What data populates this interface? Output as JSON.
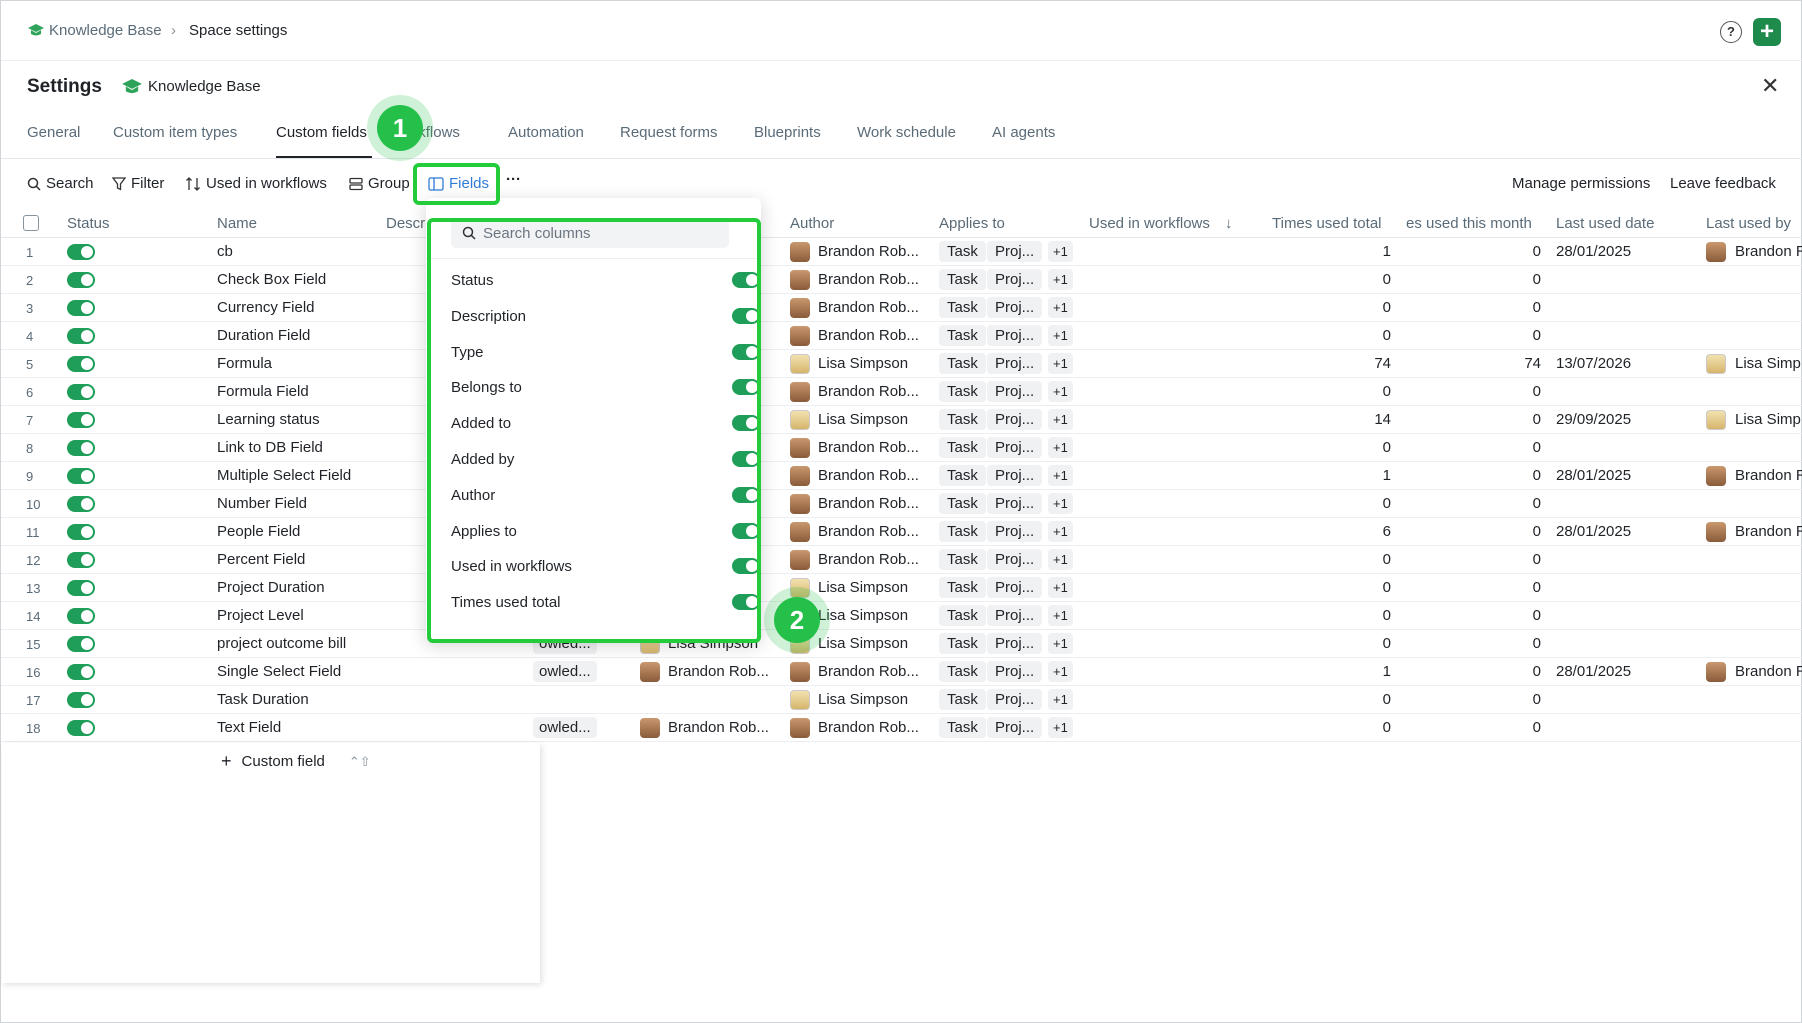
{
  "breadcrumb": {
    "workspace": "Knowledge Base",
    "current": "Space settings"
  },
  "header": {
    "help_label": "?",
    "add_label": "+",
    "title": "Settings",
    "workspace": "Knowledge Base",
    "close_label": "✕"
  },
  "tabs": [
    {
      "label": "General"
    },
    {
      "label": "Custom item types"
    },
    {
      "label": "Custom fields"
    },
    {
      "label": "Workflows"
    },
    {
      "label": "Automation"
    },
    {
      "label": "Request forms"
    },
    {
      "label": "Blueprints"
    },
    {
      "label": "Work schedule"
    },
    {
      "label": "AI agents"
    }
  ],
  "toolbar": {
    "search": "Search",
    "filter": "Filter",
    "used_in_workflows": "Used in workflows",
    "group": "Group",
    "fields": "Fields",
    "more": "···",
    "manage_permissions": "Manage permissions",
    "leave_feedback": "Leave feedback"
  },
  "columns": {
    "status": "Status",
    "name": "Name",
    "description": "Descr",
    "author": "Author",
    "applies_to": "Applies to",
    "used_in_workflows": "Used in workflows",
    "times_used_total": "Times used total",
    "times_used_month": "es used this month",
    "last_used_date": "Last used date",
    "last_used_by": "Last used by"
  },
  "rows": [
    {
      "idx": "1",
      "name": "cb",
      "author": "Brandon Rob...",
      "author_avatar": "b",
      "tag1": "Task",
      "tag2": "Proj...",
      "more": "+1",
      "total": "1",
      "month": "0",
      "date": "28/01/2025",
      "last_by": "Brandon R",
      "last_avatar": "b"
    },
    {
      "idx": "2",
      "name": "Check Box Field",
      "author": "Brandon Rob...",
      "author_avatar": "b",
      "tag1": "Task",
      "tag2": "Proj...",
      "more": "+1",
      "total": "0",
      "month": "0",
      "date": "",
      "last_by": "",
      "last_avatar": ""
    },
    {
      "idx": "3",
      "name": "Currency Field",
      "author": "Brandon Rob...",
      "author_avatar": "b",
      "tag1": "Task",
      "tag2": "Proj...",
      "more": "+1",
      "total": "0",
      "month": "0",
      "date": "",
      "last_by": "",
      "last_avatar": ""
    },
    {
      "idx": "4",
      "name": "Duration Field",
      "author": "Brandon Rob...",
      "author_avatar": "b",
      "tag1": "Task",
      "tag2": "Proj...",
      "more": "+1",
      "total": "0",
      "month": "0",
      "date": "",
      "last_by": "",
      "last_avatar": ""
    },
    {
      "idx": "5",
      "name": "Formula",
      "author": "Lisa Simpson",
      "author_avatar": "l",
      "tag1": "Task",
      "tag2": "Proj...",
      "more": "+1",
      "total": "74",
      "month": "74",
      "date": "13/07/2026",
      "last_by": "Lisa Simp",
      "last_avatar": "l"
    },
    {
      "idx": "6",
      "name": "Formula Field",
      "author": "Brandon Rob...",
      "author_avatar": "b",
      "tag1": "Task",
      "tag2": "Proj...",
      "more": "+1",
      "total": "0",
      "month": "0",
      "date": "",
      "last_by": "",
      "last_avatar": ""
    },
    {
      "idx": "7",
      "name": "Learning status",
      "author": "Lisa Simpson",
      "author_avatar": "l",
      "tag1": "Task",
      "tag2": "Proj...",
      "more": "+1",
      "total": "14",
      "month": "0",
      "date": "29/09/2025",
      "last_by": "Lisa Simp",
      "last_avatar": "l"
    },
    {
      "idx": "8",
      "name": "Link to DB Field",
      "author": "Brandon Rob...",
      "author_avatar": "b",
      "tag1": "Task",
      "tag2": "Proj...",
      "more": "+1",
      "total": "0",
      "month": "0",
      "date": "",
      "last_by": "",
      "last_avatar": ""
    },
    {
      "idx": "9",
      "name": "Multiple Select Field",
      "author": "Brandon Rob...",
      "author_avatar": "b",
      "tag1": "Task",
      "tag2": "Proj...",
      "more": "+1",
      "total": "1",
      "month": "0",
      "date": "28/01/2025",
      "last_by": "Brandon R",
      "last_avatar": "b"
    },
    {
      "idx": "10",
      "name": "Number Field",
      "author": "Brandon Rob...",
      "author_avatar": "b",
      "tag1": "Task",
      "tag2": "Proj...",
      "more": "+1",
      "total": "0",
      "month": "0",
      "date": "",
      "last_by": "",
      "last_avatar": ""
    },
    {
      "idx": "11",
      "name": "People Field",
      "author": "Brandon Rob...",
      "author_avatar": "b",
      "tag1": "Task",
      "tag2": "Proj...",
      "more": "+1",
      "total": "6",
      "month": "0",
      "date": "28/01/2025",
      "last_by": "Brandon R",
      "last_avatar": "b"
    },
    {
      "idx": "12",
      "name": "Percent Field",
      "author": "Brandon Rob...",
      "author_avatar": "b",
      "tag1": "Task",
      "tag2": "Proj...",
      "more": "+1",
      "total": "0",
      "month": "0",
      "date": "",
      "last_by": "",
      "last_avatar": ""
    },
    {
      "idx": "13",
      "name": "Project Duration",
      "author": "Lisa Simpson",
      "author_avatar": "l",
      "tag1": "Task",
      "tag2": "Proj...",
      "more": "+1",
      "total": "0",
      "month": "0",
      "date": "",
      "last_by": "",
      "last_avatar": ""
    },
    {
      "idx": "14",
      "name": "Project Level",
      "author": "Lisa Simpson",
      "author_avatar": "l",
      "tag1": "Task",
      "tag2": "Proj...",
      "more": "+1",
      "total": "0",
      "month": "0",
      "date": "",
      "last_by": "",
      "last_avatar": ""
    },
    {
      "idx": "15",
      "name": "project outcome bill",
      "author": "Lisa Simpson",
      "author_avatar": "l",
      "tag1": "Task",
      "tag2": "Proj...",
      "more": "+1",
      "total": "0",
      "month": "0",
      "date": "",
      "last_by": "",
      "last_avatar": "",
      "belongs": "owled...",
      "added_by": "Lisa Simpson",
      "added_avatar": "l"
    },
    {
      "idx": "16",
      "name": "Single Select Field",
      "author": "Brandon Rob...",
      "author_avatar": "b",
      "tag1": "Task",
      "tag2": "Proj...",
      "more": "+1",
      "total": "1",
      "month": "0",
      "date": "28/01/2025",
      "last_by": "Brandon R",
      "last_avatar": "b",
      "belongs": "owled...",
      "added_by": "Brandon Rob...",
      "added_avatar": "b"
    },
    {
      "idx": "17",
      "name": "Task Duration",
      "author": "Lisa Simpson",
      "author_avatar": "l",
      "tag1": "Task",
      "tag2": "Proj...",
      "more": "+1",
      "total": "0",
      "month": "0",
      "date": "",
      "last_by": "",
      "last_avatar": ""
    },
    {
      "idx": "18",
      "name": "Text Field",
      "author": "Brandon Rob...",
      "author_avatar": "b",
      "tag1": "Task",
      "tag2": "Proj...",
      "more": "+1",
      "total": "0",
      "month": "0",
      "date": "",
      "last_by": "",
      "last_avatar": "",
      "belongs": "owled...",
      "added_by": "Brandon Rob...",
      "added_avatar": "b"
    }
  ],
  "add_field": {
    "label": "Custom field",
    "shortcut": "⌃⇧"
  },
  "fields_menu": {
    "search_placeholder": "Search columns",
    "items": [
      {
        "label": "Status",
        "on": true
      },
      {
        "label": "Description",
        "on": true
      },
      {
        "label": "Type",
        "on": true
      },
      {
        "label": "Belongs to",
        "on": true
      },
      {
        "label": "Added to",
        "on": true
      },
      {
        "label": "Added by",
        "on": true
      },
      {
        "label": "Author",
        "on": true
      },
      {
        "label": "Applies to",
        "on": true
      },
      {
        "label": "Used in workflows",
        "on": true
      },
      {
        "label": "Times used total",
        "on": true
      }
    ]
  },
  "annotations": [
    {
      "label": "1"
    },
    {
      "label": "2"
    }
  ],
  "colors": {
    "accent": "#1e9e58",
    "link": "#2f7bd6",
    "highlight": "#22cc3a",
    "brand": "#1e8a4c"
  }
}
